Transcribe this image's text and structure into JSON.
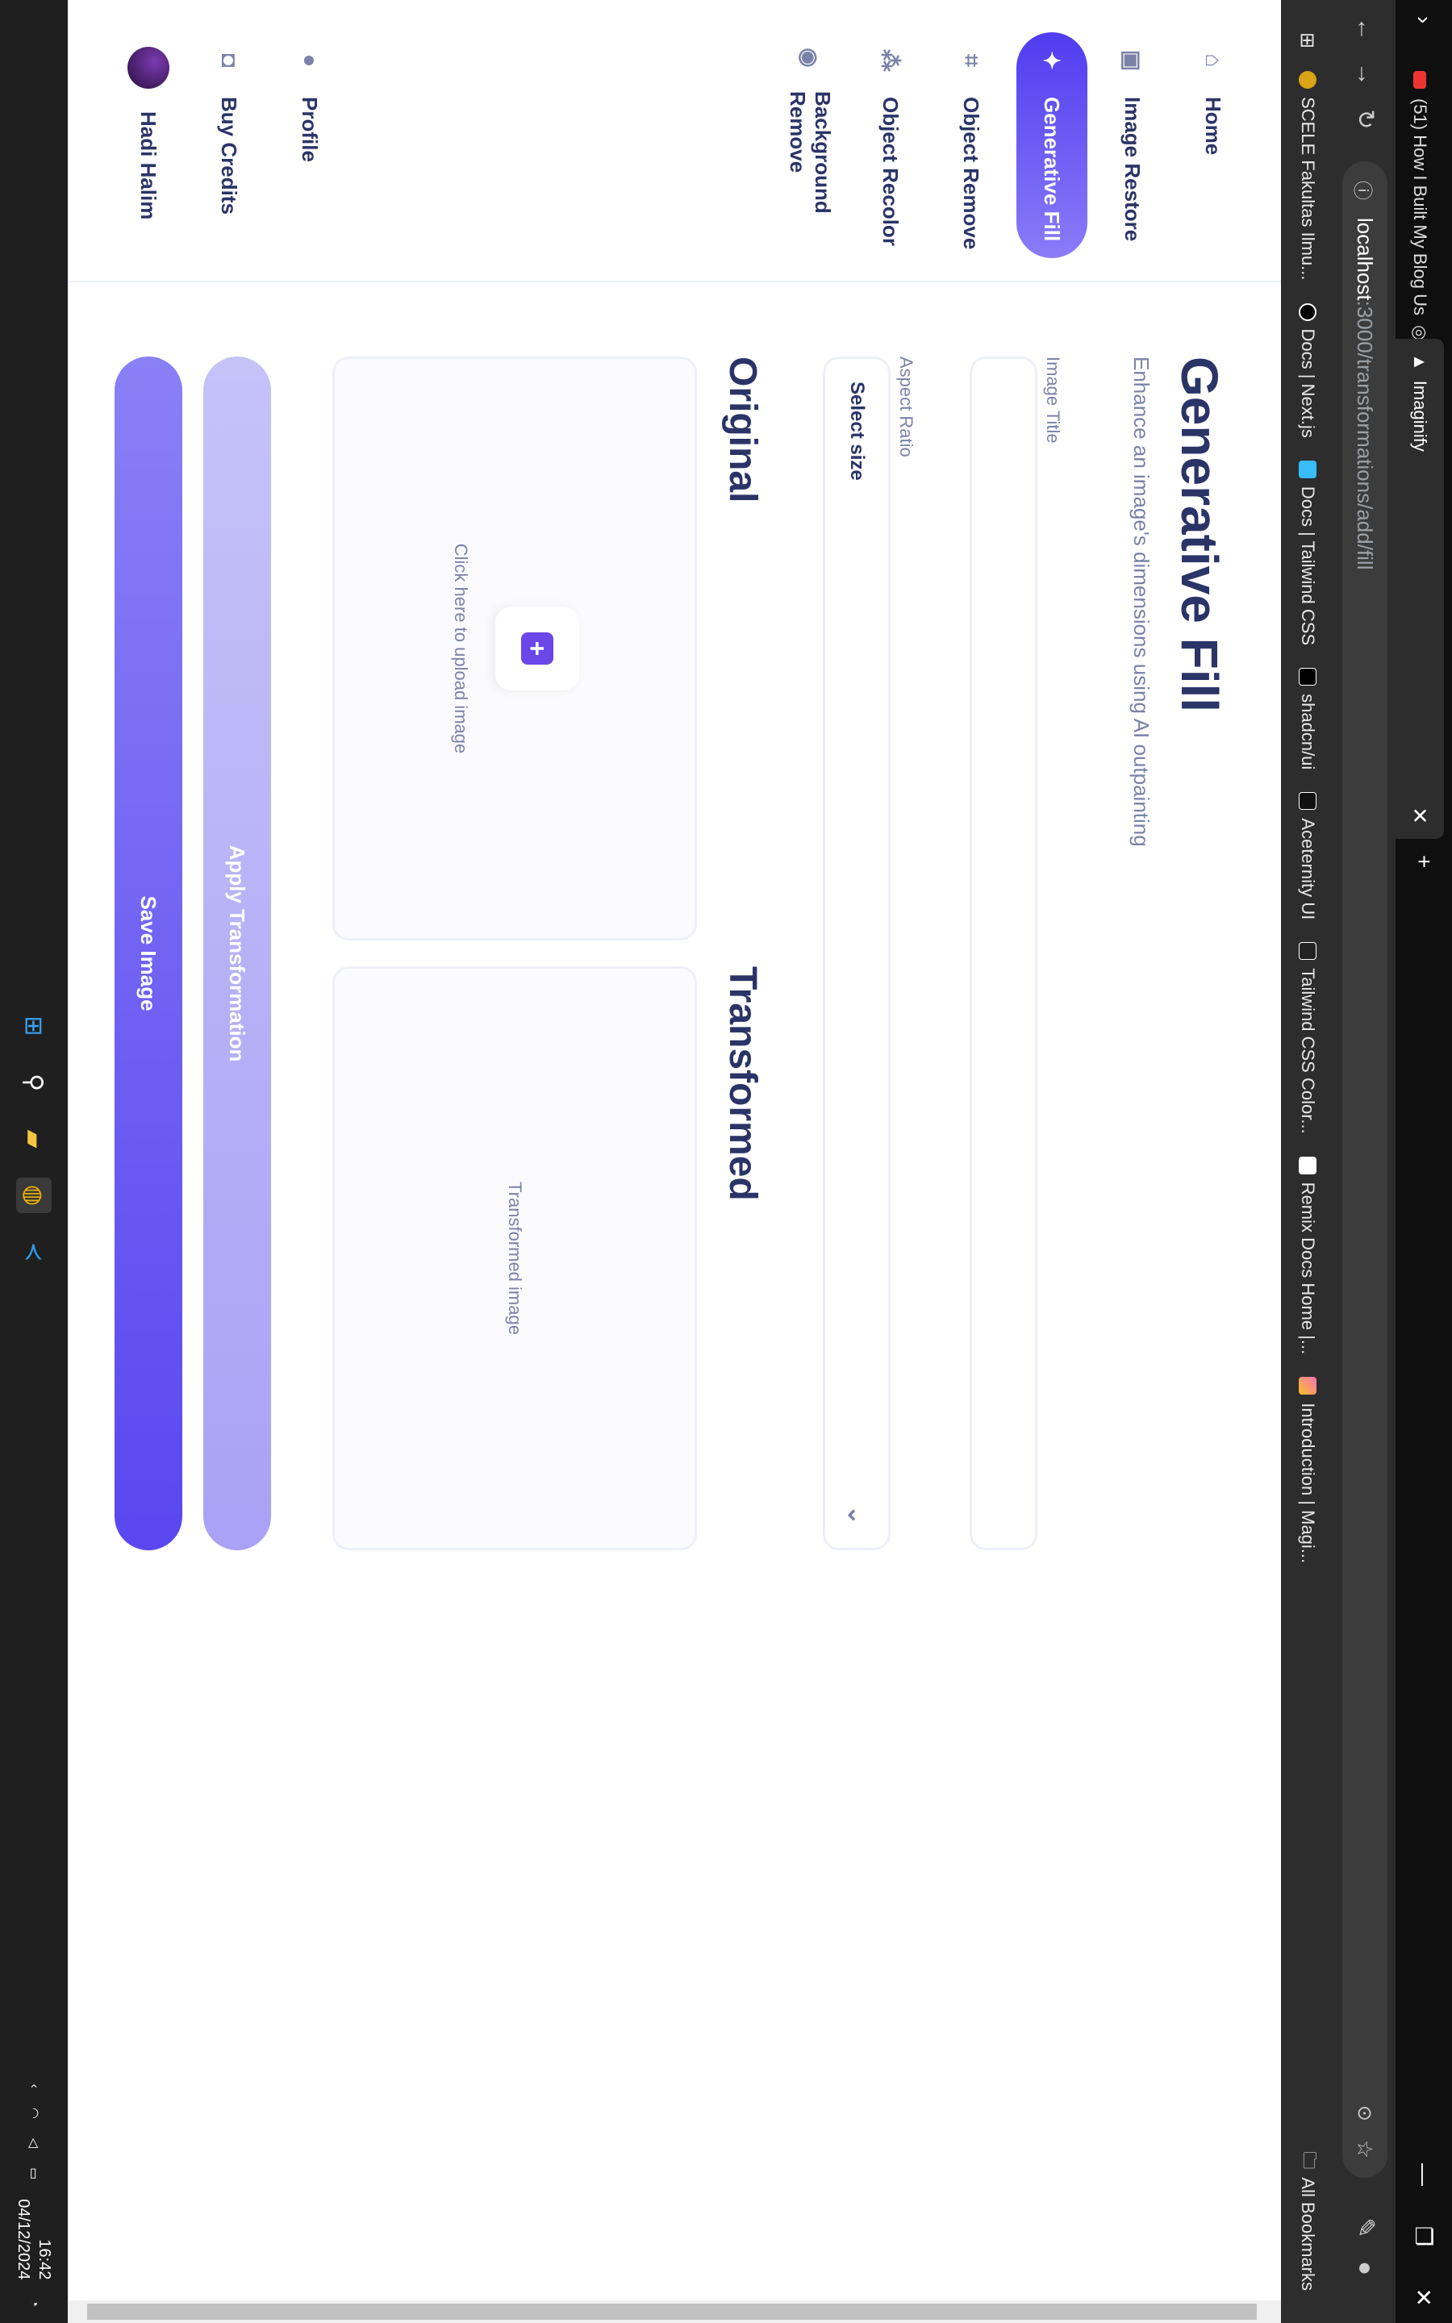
{
  "browser": {
    "tabs": [
      {
        "title": "(51) How I Built My Blog Us",
        "active": false
      },
      {
        "title": "Imaginify",
        "active": true
      }
    ],
    "new_tab_label": "+",
    "address": {
      "host": "localhost",
      "path": ":3000/transformations/add/fill"
    },
    "bookmarks": [
      "SCELE Fakultas Ilmu...",
      "Docs | Next.js",
      "Docs | Tailwind CSS",
      "shadcn/ui",
      "Aceternity UI",
      "Tailwind CSS Color...",
      "Remix Docs Home |...",
      "Introduction | Magi..."
    ],
    "all_bookmarks": "All Bookmarks"
  },
  "sidebar": {
    "items": [
      {
        "label": "Home",
        "icon": "home-icon"
      },
      {
        "label": "Image Restore",
        "icon": "image-icon"
      },
      {
        "label": "Generative Fill",
        "icon": "sparkles-icon",
        "active": true
      },
      {
        "label": "Object Remove",
        "icon": "scan-icon"
      },
      {
        "label": "Object Recolor",
        "icon": "filter-icon"
      },
      {
        "label": "Background Remove",
        "icon": "camera-icon"
      }
    ],
    "bottom": [
      {
        "label": "Profile",
        "icon": "profile-icon"
      },
      {
        "label": "Buy Credits",
        "icon": "bag-icon"
      },
      {
        "label": "Hadi Halim",
        "icon": "avatar"
      }
    ]
  },
  "main": {
    "title": "Generative Fill",
    "subtitle": "Enhance an image's dimensions using AI outpainting",
    "image_title_label": "Image Title",
    "image_title_value": "",
    "aspect_ratio_label": "Aspect Ratio",
    "aspect_ratio_value": "Select size",
    "original_heading": "Original",
    "transformed_heading": "Transformed",
    "upload_text": "Click here to upload image",
    "transformed_placeholder": "Transformed image",
    "apply_button": "Apply Transformation",
    "save_button": "Save Image"
  },
  "taskbar": {
    "time": "16:42",
    "date": "04/12/2024"
  },
  "colors": {
    "accent": "#5a47f0",
    "text_dark": "#2b3467",
    "text_muted": "#7a82a8"
  }
}
